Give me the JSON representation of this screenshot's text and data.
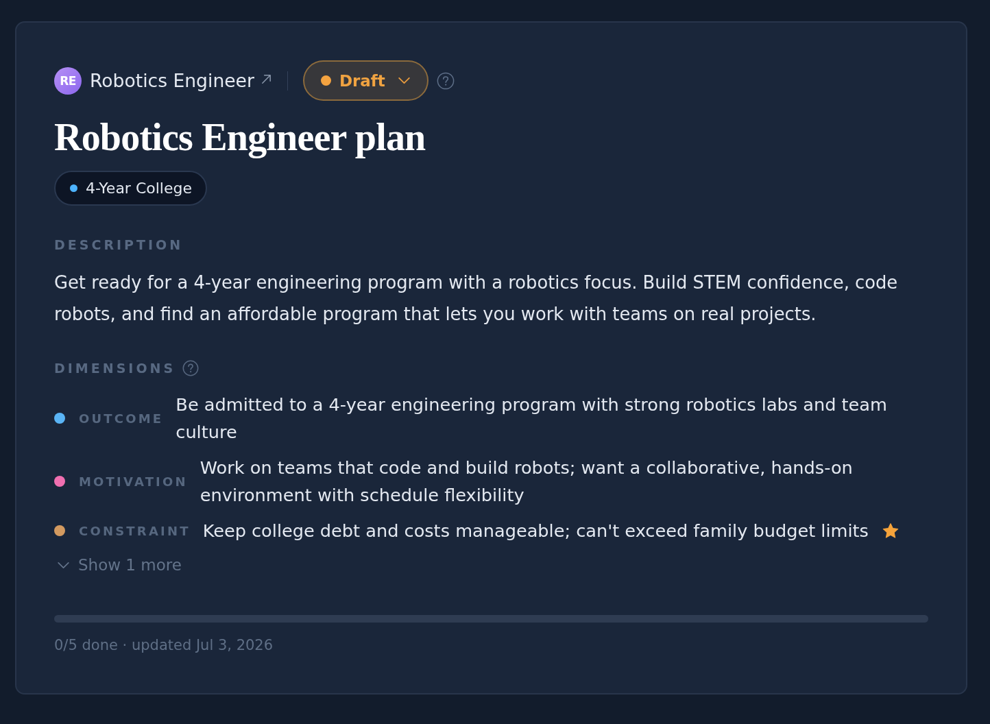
{
  "header": {
    "avatar_initials": "RE",
    "role_link": "Robotics Engineer",
    "status": {
      "label": "Draft"
    }
  },
  "title": "Robotics Engineer plan",
  "tags": [
    {
      "label": "4-Year College",
      "color": "#4db3ff"
    }
  ],
  "description": {
    "heading": "DESCRIPTION",
    "text": "Get ready for a 4-year engineering program with a robotics focus. Build STEM confidence, code robots, and find an affordable program that lets you work with teams on real projects."
  },
  "dimensions": {
    "heading": "DIMENSIONS",
    "items": [
      {
        "label": "OUTCOME",
        "color": "#5ab4f5",
        "text": "Be admitted to a 4-year engineering program with strong robotics labs and team culture",
        "starred": false
      },
      {
        "label": "MOTIVATION",
        "color": "#f06fb0",
        "text": "Work on teams that code and build robots; want a collaborative, hands-on environment with schedule flexibility",
        "starred": false
      },
      {
        "label": "CONSTRAINT",
        "color": "#d39a60",
        "text": "Keep college debt and costs manageable; can't exceed family budget limits",
        "starred": true
      }
    ],
    "show_more": "Show 1 more"
  },
  "progress": {
    "level": 0
  },
  "footer": "0/5 done · updated Jul 3, 2026"
}
